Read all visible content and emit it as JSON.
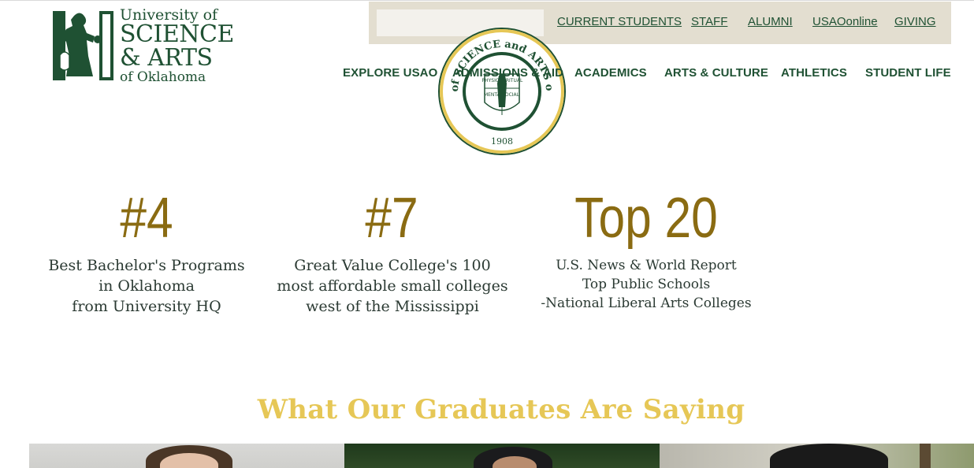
{
  "logo": {
    "line1": "University of",
    "line2": "SCIENCE",
    "line3": "& ARTS",
    "line4": "of Oklahoma"
  },
  "utility": {
    "search_placeholder": "",
    "links": [
      "CURRENT STUDENTS",
      "STAFF",
      "ALUMNI",
      "USAOonline",
      "GIVING"
    ]
  },
  "nav": {
    "items": [
      "EXPLORE USAO",
      "ADMISSIONS & AID",
      "ACADEMICS",
      "ARTS & CULTURE",
      "ATHLETICS",
      "STUDENT LIFE"
    ]
  },
  "seal": {
    "ring_text": "UNIVERSITY of SCIENCE and ARTS of OKLAHOMA",
    "quad": [
      "PHYSICAL",
      "SPIRITUAL",
      "MENTAL",
      "SOCIAL"
    ],
    "year": "1908"
  },
  "rankings": [
    {
      "number": "#4",
      "text": "Best Bachelor's Programs\nin Oklahoma\nfrom University HQ"
    },
    {
      "number": "#7",
      "text": "Great Value College's 100\nmost affordable small colleges\nwest of the Mississippi"
    },
    {
      "number": "Top 20",
      "text": "U.S. News & World Report\nTop Public Schools\n-National Liberal Arts Colleges"
    }
  ],
  "testimonials": {
    "title": "What Our Graduates Are Saying"
  },
  "colors": {
    "brand_green": "#1f5133",
    "gold": "#8a6b12",
    "title_gold": "#e6c756",
    "utility_bg": "#e3ded0"
  }
}
